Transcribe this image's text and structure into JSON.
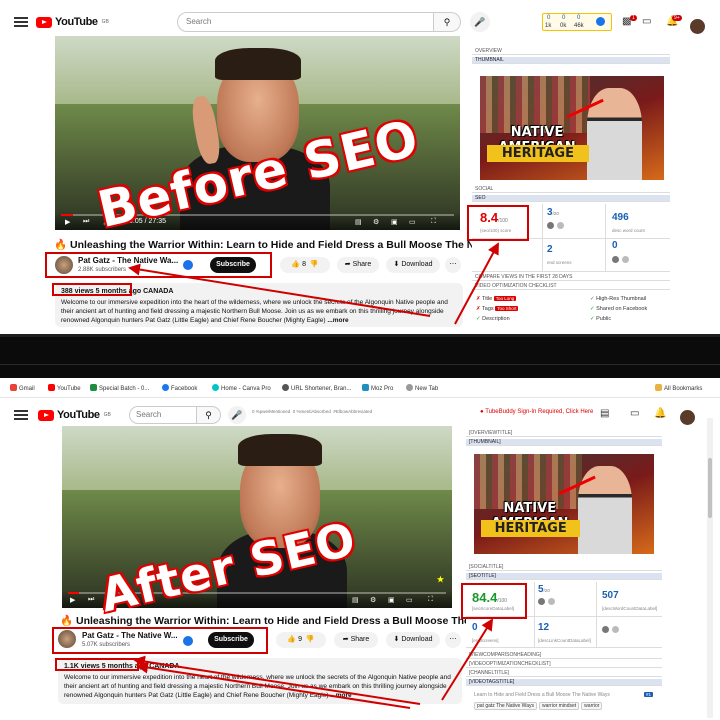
{
  "top": {
    "masthead": {
      "logo": "YouTube",
      "logo_sup": "GB",
      "search_placeholder": "Search",
      "ext_counts": [
        "0",
        "0",
        "0",
        "0"
      ],
      "ext_labels": [
        "1k",
        "0k",
        "46k",
        "0"
      ],
      "notif_count": "9+"
    },
    "overlay": "Before SEO",
    "video_time": "0:05 / 27:35",
    "title": "Unleashing the Warrior Within: Learn to Hide and Field Dress a Bull Moose The Native Ways!",
    "channel_name": "Pat Gatz - The Native Wa...",
    "subscribers": "2.88K subscribers",
    "subscribe": "Subscribe",
    "likes": "8",
    "share": "Share",
    "download": "Download",
    "meta": "388 views  5 months ago  CANADA",
    "description": "Welcome to our immersive expedition into the heart of the wilderness, where we unlock the secrets of the Algonquin Native people and their ancient art of hunting and field dressing a majestic Northern Bull Moose. Join us as we embark on this thrilling journey alongside renowned Algonquin hunters Pat Gatz (Little Eagle) and Chief Rene Boucher (Mighty Eagle)",
    "more": "...more",
    "sidebar": {
      "overview": "OVERVIEW",
      "thumbnail": "THUMBNAIL",
      "social": "SOCIAL",
      "seo": "SEO",
      "score": "8.4",
      "score_of": "/100",
      "score_caption": "(seo/100) score",
      "n1": "3",
      "n1_of": "/20",
      "n2": "496",
      "n2_caption": "desc word count",
      "n3": "2",
      "n3_caption": "end screens",
      "n4": "0",
      "compare": "COMPARE VIEWS IN THE FIRST 28 DAYS",
      "checklist": "VIDEO OPTIMIZATION CHECKLIST",
      "checks_left": [
        "Title",
        "Tags",
        "Description"
      ],
      "check_tags": [
        "Too Long",
        "Too Short"
      ],
      "checks_right": [
        "High-Res Thumbnail",
        "Shared on Facebook",
        "Public"
      ]
    },
    "thumb_text1": "NATIVE AMERICAN",
    "thumb_text2": "HERITAGE"
  },
  "bottom": {
    "bookmarks": [
      "Gmail",
      "YouTube",
      "Special Batch - 0...",
      "Facebook",
      "Home - Canva Pro",
      "URL Shortener, Bran...",
      "Moz Pro",
      "New Tab"
    ],
    "all_bookmarks": "All Bookmarks",
    "masthead": {
      "logo": "YouTube",
      "logo_sup": "GB",
      "search_placeholder": "Search",
      "ext_vals": [
        "0 %pwe/Mentioned",
        "0 %mentiAbsorbed",
        "#ElbowAbbreviated"
      ]
    },
    "tubebuddy": "TubeBuddy Sign-In Required, Click Here",
    "overlay": "After SEO",
    "title": "Unleashing the Warrior Within: Learn to Hide and Field Dress a Bull Moose The Native Ways!",
    "channel_name": "Pat Gatz - The Native W...",
    "subscribers": "5.07K subscribers",
    "subscribe": "Subscribe",
    "likes": "9",
    "share": "Share",
    "download": "Download",
    "meta": "1.1K views  5 months ago  CANADA",
    "description": "Welcome to our immersive expedition into the heart of the wilderness, where we unlock the secrets of the Algonquin Native people and their ancient art of hunting and field dressing a majestic Northern Bull Moose. Join us as we embark on this thrilling journey alongside renowned Algonquin hunters Pat Gatz (Little Eagle) and Chief Rene Boucher (Mighty Eagle)",
    "more": "...more",
    "sidebar": {
      "overview": "[OVERVIEWTITLE]",
      "thumbnail": "[THUMBNAIL]",
      "social": "[SOCIALTITLE]",
      "seo": "[SEOTITLE]",
      "score": "84.4",
      "score_of": "/100",
      "score_caption": "[seoScoreDataLabel]",
      "n1": "5",
      "n1_of": "/20",
      "n2": "507",
      "n2_caption": "[descWordCountDataLabel]",
      "n3": "0",
      "n3_caption": "[endScreens]",
      "n4": "12",
      "n4_caption": "[descLinkCountDataLabel]",
      "compare": "[VIEWCOMPARISONHEADING]",
      "checklist1": "[VIDEOOPTIMIZATIONCHECKLIST]",
      "checklist2": "[CHANNELTITLE]",
      "videotags": "[VIDEOTAGSTITLE]",
      "tags_line": "Learn to Hide and Field Dress a Bull Moose The Native Ways",
      "tags": [
        "pat gatz The Native Ways",
        "warrior mindset",
        "warrior"
      ],
      "tag_count": "#1"
    },
    "thumb_text1": "NATIVE AMERICAN",
    "thumb_text2": "HERITAGE"
  }
}
